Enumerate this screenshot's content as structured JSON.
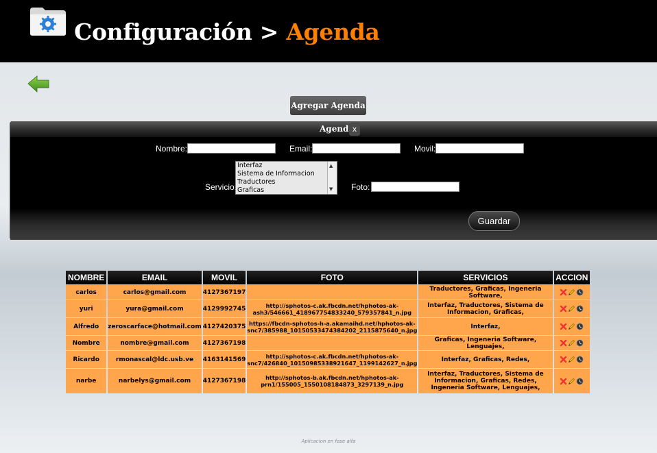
{
  "header": {
    "title_prefix": "Configuración",
    "separator": " > ",
    "title_accent": "Agenda",
    "accent_color": "#ff7f00",
    "icon": "settings-folder-icon"
  },
  "nav": {
    "back_icon": "back-arrow-icon"
  },
  "toolbar": {
    "add_label": "Agregar Agenda"
  },
  "form": {
    "panel_title": "Agenda",
    "close_label": "x",
    "nombre_label": "Nombre:",
    "email_label": "Email:",
    "movil_label": "Movil:",
    "servicio_label": "Servicio:",
    "foto_label": "Foto:",
    "servicio_options": [
      "Interfaz",
      "Sistema de Informacion",
      "Traductores",
      "Graficas"
    ],
    "save_label": "Guardar"
  },
  "table": {
    "columns": [
      "NOMBRE",
      "EMAIL",
      "MOVIL",
      "FOTO",
      "SERVICIOS",
      "ACCION"
    ],
    "rows": [
      {
        "nombre": "carlos",
        "email": "carlos@gmail.com",
        "movil": "4127367197",
        "foto": "",
        "servicios": "Traductores, Graficas, Ingeneria Software,"
      },
      {
        "nombre": "yuri",
        "email": "yura@gmail.com",
        "movil": "4129992745",
        "foto": "http://sphotos-c.ak.fbcdn.net/hphotos-ak-ash3/546661_418967754833240_579357841_n.jpg",
        "servicios": "Interfaz, Traductores, Sistema de Informacion, Graficas,"
      },
      {
        "nombre": "Alfredo",
        "email": "zeroscarface@hotmail.com",
        "movil": "4127420375",
        "foto": "https://fbcdn-sphotos-h-a.akamaihd.net/hphotos-ak-snc7/385988_10150533474384202_2115875640_n.jpg",
        "servicios": "Interfaz,"
      },
      {
        "nombre": "Nombre",
        "email": "nombre@gmail.com",
        "movil": "4127367198",
        "foto": "",
        "servicios": "Graficas, Ingeneria Software, Lenguajes,"
      },
      {
        "nombre": "Ricardo",
        "email": "rmonascal@ldc.usb.ve",
        "movil": "4163141569",
        "foto": "http://sphotos-c.ak.fbcdn.net/hphotos-ak-snc7/426840_10150985338921647_1199142627_n.jpg",
        "servicios": "Interfaz, Graficas, Redes,"
      },
      {
        "nombre": "narbe",
        "email": "narbelys@gmail.com",
        "movil": "4127367198",
        "foto": "http://sphotos-b.ak.fbcdn.net/hphotos-ak-prn1/155005_1550108184873_3297139_n.jpg",
        "servicios": "Interfaz, Traductores, Sistema de Informacion, Graficas, Redes, Ingeneria Software, Lenguajes,"
      }
    ],
    "row_bg": "#ffa64d",
    "action_icons": [
      "delete-icon",
      "edit-icon",
      "history-icon"
    ]
  },
  "footer": {
    "note": "Aplicacion en fase alfa"
  }
}
